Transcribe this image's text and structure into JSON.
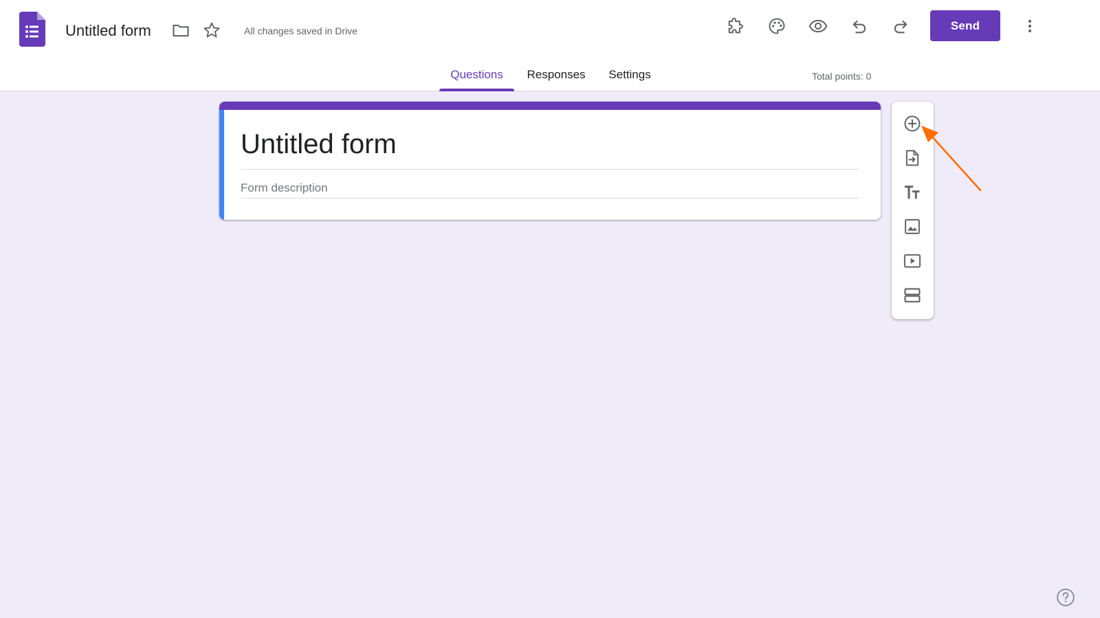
{
  "header": {
    "title": "Untitled form",
    "save_status": "All changes saved in Drive",
    "send_label": "Send",
    "icons": [
      "forms-logo-icon",
      "folder-icon",
      "star-icon",
      "puzzle-addon-icon",
      "palette-icon",
      "eye-preview-icon",
      "undo-icon",
      "redo-icon",
      "more-vert-icon"
    ]
  },
  "tabs": [
    {
      "label": "Questions",
      "active": true
    },
    {
      "label": "Responses",
      "active": false
    },
    {
      "label": "Settings",
      "active": false
    }
  ],
  "total_points": "Total points: 0",
  "form": {
    "title": "Untitled form",
    "description_placeholder": "Form description"
  },
  "toolbar": {
    "items": [
      "add-question-icon",
      "import-questions-icon",
      "add-title-icon",
      "add-image-icon",
      "add-video-icon",
      "add-section-icon"
    ]
  },
  "colors": {
    "accent": "#673ab7",
    "page_bg": "#f0ebf8",
    "card_left_accent": "#4285f4",
    "annotation_arrow": "#ff6d00"
  }
}
